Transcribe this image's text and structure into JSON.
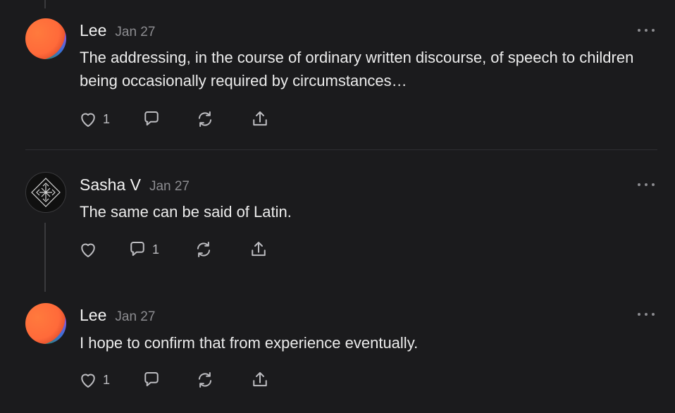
{
  "comments": [
    {
      "author": "Lee",
      "date": "Jan 27",
      "text": "The addressing, in the course of ordinary written discourse, of speech to children being occasionally required by circumstances…",
      "like_count": "1",
      "reply_count": ""
    },
    {
      "author": "Sasha V",
      "date": "Jan 27",
      "text": "The same can be said of Latin.",
      "like_count": "",
      "reply_count": "1"
    },
    {
      "author": "Lee",
      "date": "Jan 27",
      "text": "I hope to confirm that from experience eventually.",
      "like_count": "1",
      "reply_count": ""
    }
  ],
  "icons": {
    "like": "heart-icon",
    "reply": "speech-bubble-icon",
    "restack": "restack-icon",
    "share": "share-icon",
    "more": "ellipsis-icon"
  },
  "colors": {
    "background": "#1b1b1d",
    "text": "#ececec",
    "muted": "#8c8c90",
    "avatar_orange": "#ff6a3a"
  }
}
